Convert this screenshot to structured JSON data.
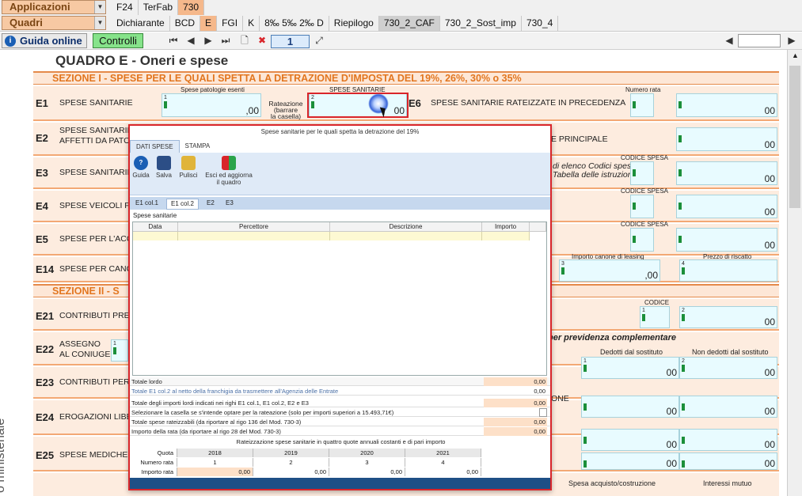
{
  "top": {
    "applicazioni": "Applicazioni",
    "quadri": "Quadri",
    "row1_tabs": [
      "F24",
      "TerFab",
      "730"
    ],
    "row2_tabs": [
      "Dichiarante",
      "BCD",
      "E",
      "FGI",
      "K",
      "8‰ 5‰ 2‰ D",
      "Riepilogo",
      "730_2_CAF",
      "730_2_Sost_imp",
      "730_4"
    ]
  },
  "toolbar": {
    "guida": "Guida online",
    "controlli": "Controlli",
    "page": "1"
  },
  "quadro": {
    "title": "QUADRO E - Oneri e spese",
    "sez1": "SEZIONE I - SPESE PER LE QUALI SPETTA LA DETRAZIONE D'IMPOSTA DEL 19%, 26%, 30% o 35%",
    "sez2": "SEZIONE II - S",
    "side": "o ministeriale"
  },
  "rows": [
    {
      "code": "E1",
      "label": "SPESE SANITARIE"
    },
    {
      "code": "E2",
      "label": "SPESE SANITARIE P\nAFFETTI DA PATOL"
    },
    {
      "code": "E3",
      "label": "SPESE SANITARIE"
    },
    {
      "code": "E4",
      "label": "SPESE VEICOLI PE"
    },
    {
      "code": "E5",
      "label": "SPESE PER L'ACQU"
    },
    {
      "code": "E14",
      "label": "SPESE PER CANO"
    },
    {
      "code": "E21",
      "label": "CONTRIBUTI PREV"
    },
    {
      "code": "E22",
      "label": "ASSEGNO\nAL CONIUGE"
    },
    {
      "code": "E23",
      "label": "CONTRIBUTI PER A"
    },
    {
      "code": "E24",
      "label": "EROGAZIONI LIBER"
    },
    {
      "code": "E25",
      "label": "SPESE MEDICHE E"
    }
  ],
  "e1": {
    "patologie": "Spese patologie esenti",
    "spese_sanitarie": "SPESE SANITARIE",
    "rateazione": "Rateazione\n(barrare\nla casella)",
    "zero": ",00",
    "e6code": "E6",
    "e6label": "SPESE SANITARIE RATEIZZATE IN PRECEDENZA",
    "numero_rata": "Numero rata",
    "zero2": "00"
  },
  "right_labels": {
    "principale": "E PRINCIPALE",
    "codice_spesa": "CODICE SPESA",
    "elenco": "di elenco Codici spesa\nTabella delle istruzioni",
    "importo_canone": "Importo canone di leasing",
    "prezzo_riscatto": "Prezzo di riscatto",
    "codice": "CODICE",
    "previdenza": "per previdenza complementare",
    "dedotti": "Dedotti dal sostituto",
    "non_dedotti": "Non dedotti dal sostituto",
    "one": "ONE",
    "spesa_acquisto": "Spesa acquisto/costruzione",
    "interessi": "Interessi mutuo"
  },
  "dialog": {
    "title": "Spese sanitarie per le quali spetta la detrazione del 19%",
    "tabs": [
      "DATI SPESE",
      "STAMPA"
    ],
    "ribbon": [
      "Guida",
      "Salva",
      "Pulisci",
      "Esci ed aggiorna\nil quadro"
    ],
    "subtabs": [
      "E1 col.1",
      "E1 col.2",
      "E2",
      "E3"
    ],
    "grid_label": "Spese sanitarie",
    "columns": [
      "Data",
      "Percettore",
      "Descrizione",
      "Importo"
    ],
    "totali": [
      {
        "label": "Totale lordo",
        "value": "0,00"
      },
      {
        "label": "Totale E1 col.2 al netto della franchigia da trasmettere all'Agenzia delle Entrate",
        "value": "0,00"
      },
      {
        "label": "Totale degli importi lordi indicati nei righi E1 col.1, E1 col.2, E2 e E3",
        "value": "0,00"
      },
      {
        "label": "Selezionare la casella se s'intende optare per la rateazione (solo per importi superiori a 15.493,71€)",
        "value": ""
      },
      {
        "label": "Totale spese rateizzabili (da riportare al rigo 136 del Mod. 730-3)",
        "value": "0,00"
      },
      {
        "label": "Importo della rata (da riportare al rigo 28 del Mod. 730-3)",
        "value": "0,00"
      }
    ],
    "rate_title": "Rateizzazione spese sanitarie in quattro quote annuali costanti e di pari importo",
    "rate_table": {
      "quota": "Quota",
      "numero_rata": "Numero rata",
      "importo_rata": "Importo rata",
      "years": [
        "2018",
        "2019",
        "2020",
        "2021"
      ],
      "numbers": [
        "1",
        "2",
        "3",
        "4"
      ],
      "amounts": [
        "0,00",
        "0,00",
        "0,00",
        "0,00"
      ]
    }
  }
}
